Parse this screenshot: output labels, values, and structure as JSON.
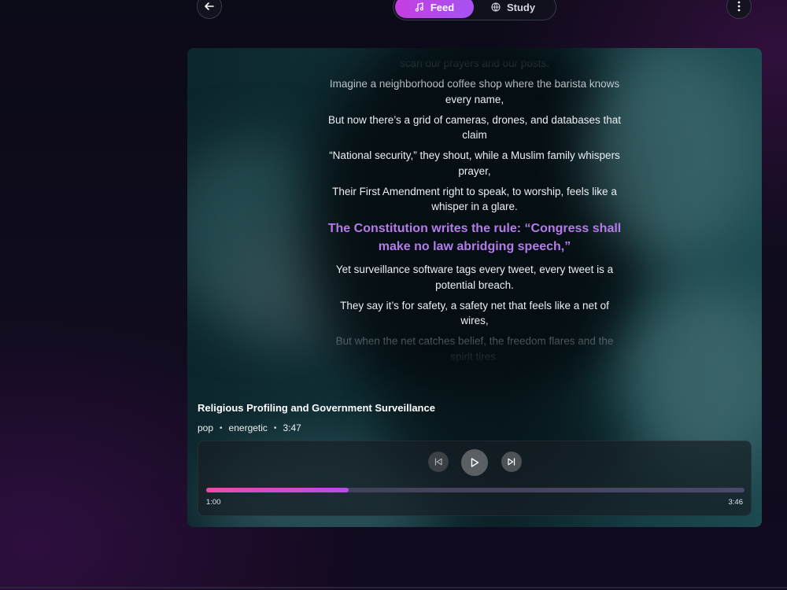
{
  "topbar": {
    "back_icon": "arrow-left-icon",
    "more_icon": "kebab-vertical-icon",
    "tabs": [
      {
        "label": "Feed",
        "icon": "music-note-icon",
        "active": true
      },
      {
        "label": "Study",
        "icon": "globe-icon",
        "active": false
      }
    ]
  },
  "lyrics": [
    {
      "text": "scan our prayers and our posts.",
      "state": "dim"
    },
    {
      "text": "Imagine a neighborhood coffee shop where the barista knows every name,",
      "state": "normal"
    },
    {
      "text": "But now there’s a grid of cameras, drones, and databases that claim",
      "state": "normal"
    },
    {
      "text": "“National security,” they shout, while a Muslim family whispers prayer,",
      "state": "normal"
    },
    {
      "text": "Their First Amendment right to speak, to worship, feels like a whisper in a glare.",
      "state": "normal"
    },
    {
      "text": "The Constitution writes the rule: “Congress shall make no law abridging speech,”",
      "state": "active"
    },
    {
      "text": "Yet surveillance software tags every tweet, every tweet is a potential breach.",
      "state": "normal"
    },
    {
      "text": "They say it’s for safety, a safety net that feels like a net of wires,",
      "state": "normal"
    },
    {
      "text": "But when the net catches belief, the freedom flares and the spirit tires.",
      "state": "dim"
    }
  ],
  "song": {
    "title": "Religious Profiling and Government Surveillance",
    "genre": "pop",
    "mood": "energetic",
    "duration": "3:47"
  },
  "player": {
    "prev_icon": "skip-previous-icon",
    "play_icon": "play-icon",
    "next_icon": "skip-next-icon",
    "current_time": "1:00",
    "total_time": "3:46",
    "progress_fraction": 0.265
  },
  "colors": {
    "accent": "#b57bea",
    "feed_tab_gradient_start": "#c43ee0",
    "feed_tab_gradient_end": "#a852f2",
    "progress_start": "#ea4ca5",
    "progress_end": "#b54de8"
  }
}
